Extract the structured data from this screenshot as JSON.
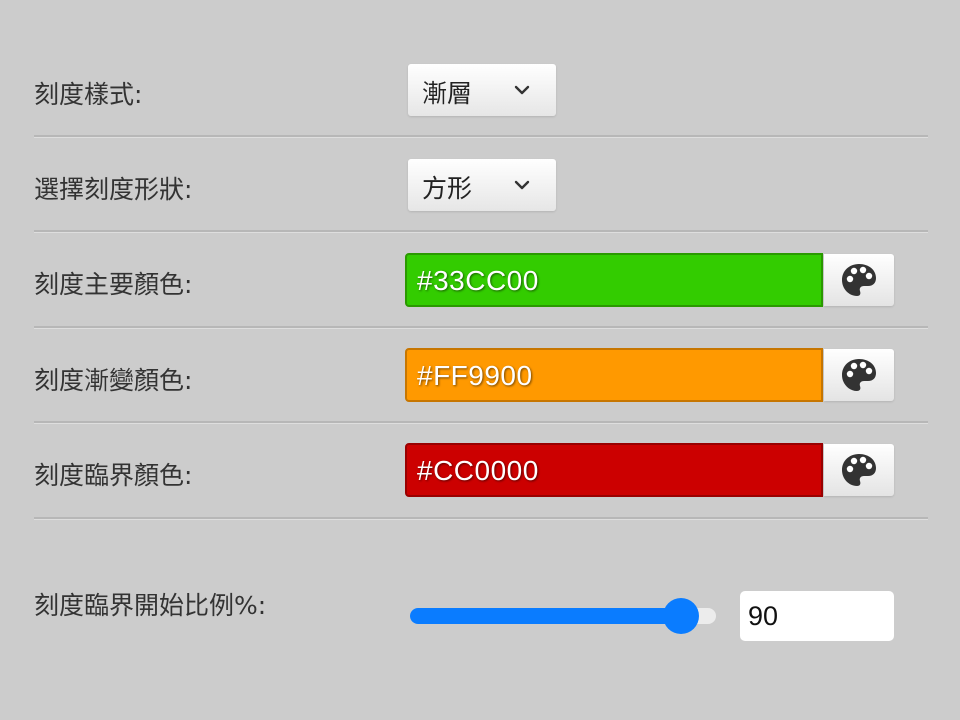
{
  "rows": [
    {
      "label": "刻度樣式:",
      "value": "漸層"
    },
    {
      "label": "選擇刻度形狀:",
      "value": "方形"
    },
    {
      "label": "刻度主要顏色:",
      "value": "#33CC00",
      "color": "#33CC00",
      "border": "#2a9900"
    },
    {
      "label": "刻度漸變顏色:",
      "value": "#FF9900",
      "color": "#FF9900",
      "border": "#c77600"
    },
    {
      "label": "刻度臨界顏色:",
      "value": "#CC0000",
      "color": "#CC0000",
      "border": "#990000"
    }
  ],
  "threshold": {
    "label": "刻度臨界開始比例%:",
    "value": "90",
    "level": 0.9
  },
  "icons": {
    "dropdown": "chevron-down-icon",
    "palette": "palette-icon"
  }
}
